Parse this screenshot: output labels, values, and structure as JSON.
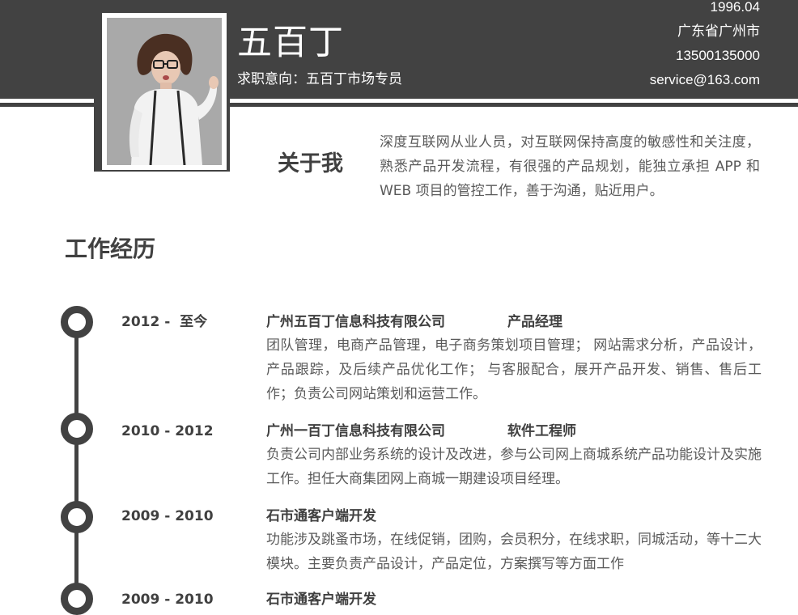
{
  "profile": {
    "name": "五百丁",
    "objective_label": "求职意向：",
    "objective_value": "五百丁市场专员",
    "birth": "1996.04",
    "location": "广东省广州市",
    "phone": "13500135000",
    "email": "service@163.com"
  },
  "about": {
    "title": "关于我",
    "text": "深度互联网从业人员，对互联网保持高度的敏感性和关注度，熟悉产品开发流程，有很强的产品规划，能独立承担 APP 和 WEB 项目的管控工作，善于沟通，贴近用户。"
  },
  "experience": {
    "title": "工作经历",
    "entries": [
      {
        "date": "2012 -  至今",
        "company": "广州五百丁信息科技有限公司",
        "role": "产品经理",
        "desc": "团队管理，电商产品管理，电子商务策划项目管理； 网站需求分析，产品设计，产品跟踪，及后续产品优化工作； 与客服配合，展开产品开发、销售、售后工作；负责公司网站策划和运营工作。"
      },
      {
        "date": "2010 - 2012",
        "company": "广州一百丁信息科技有限公司",
        "role": "软件工程师",
        "desc": "负责公司内部业务系统的设计及改进，参与公司网上商城系统产品功能设计及实施工作。担任大商集团网上商城一期建设项目经理。"
      },
      {
        "date": "2009 - 2010",
        "company": "石市通客户端开发",
        "role": "",
        "desc": "功能涉及跳蚤市场，在线促销，团购，会员积分，在线求职，同城活动，等十二大模块。主要负责产品设计，产品定位，方案撰写等方面工作"
      },
      {
        "date": "2009 - 2010",
        "company": "石市通客户端开发",
        "role": "",
        "desc": ""
      }
    ]
  },
  "colors": {
    "header": "#424242",
    "text": "#404040",
    "body_text": "#5a5a5a"
  },
  "icons": [
    "profile-photo",
    "timeline-dot-icon"
  ]
}
